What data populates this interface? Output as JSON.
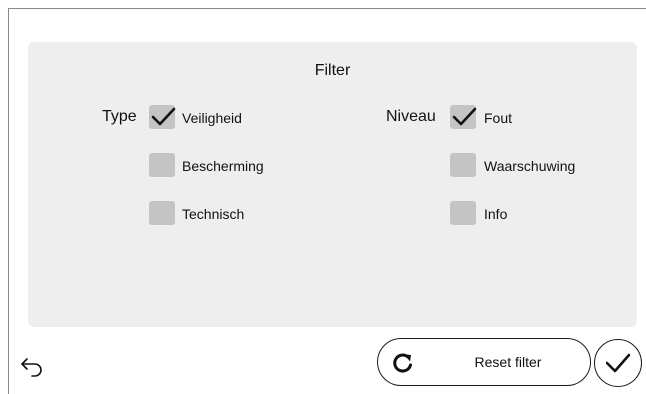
{
  "filter": {
    "title": "Filter",
    "type": {
      "label": "Type",
      "options": [
        {
          "label": "Veiligheid",
          "checked": true
        },
        {
          "label": "Bescherming",
          "checked": false
        },
        {
          "label": "Technisch",
          "checked": false
        }
      ]
    },
    "niveau": {
      "label": "Niveau",
      "options": [
        {
          "label": "Fout",
          "checked": true
        },
        {
          "label": "Waarschuwing",
          "checked": false
        },
        {
          "label": "Info",
          "checked": false
        }
      ]
    }
  },
  "footer": {
    "back_icon": "back-arrow-icon",
    "reset_label": "Reset filter",
    "reset_icon": "refresh-icon",
    "confirm_icon": "checkmark-icon"
  },
  "colors": {
    "panel_bg": "#eeeeee",
    "checkbox_bg": "#c4c4c4",
    "text": "#111111"
  }
}
